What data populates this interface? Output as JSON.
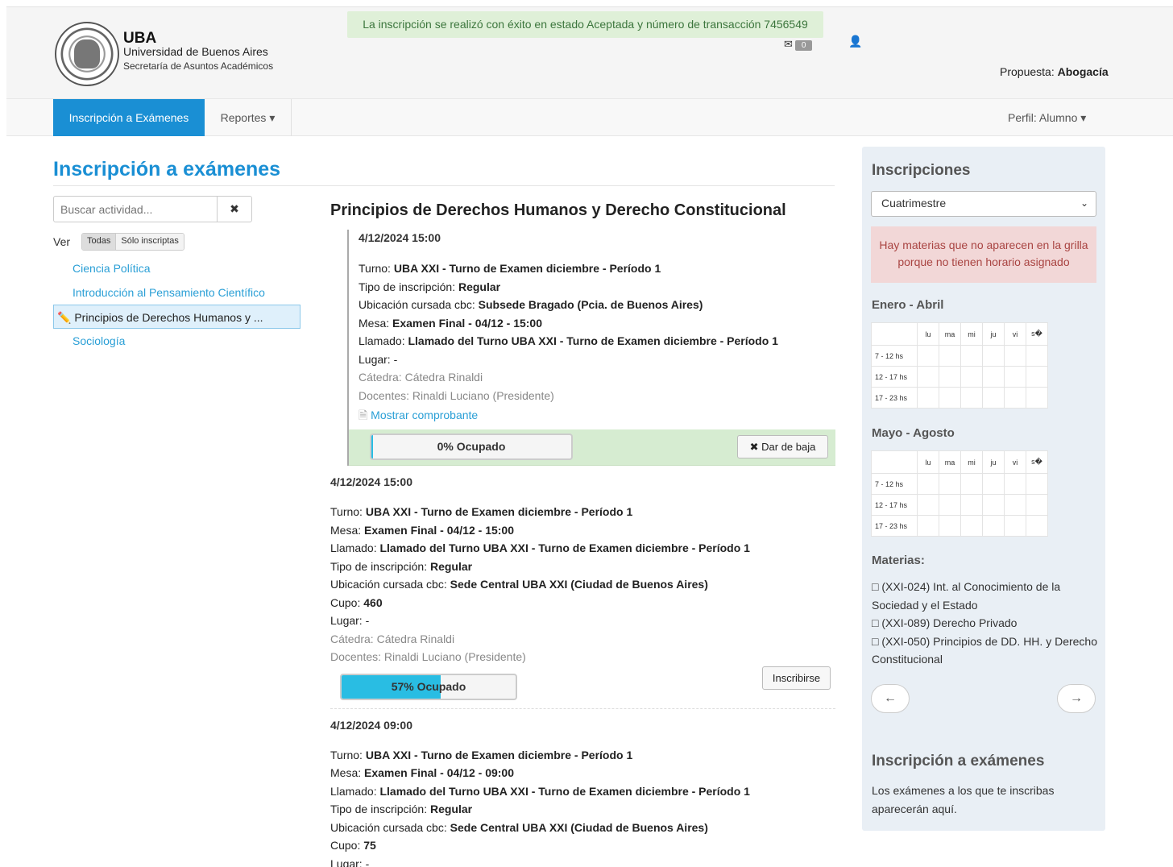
{
  "header": {
    "brand_title": "UBA",
    "brand_subtitle": "Universidad de Buenos Aires",
    "brand_subtitle2": "Secretaría de Asuntos Académicos",
    "flash": "La inscripción se realizó con éxito en estado Aceptada y número de transacción 7456549",
    "mail_count": "0",
    "propuesta_label": "Propuesta:",
    "propuesta_value": "Abogacía"
  },
  "nav": {
    "active": "Inscripción a Exámenes",
    "reportes": "Reportes ▾",
    "perfil": "Perfil: Alumno ▾"
  },
  "page": {
    "title": "Inscripción a exámenes",
    "search_placeholder": "Buscar actividad...",
    "search_clear": "✖",
    "ver_label": "Ver",
    "ver_todas": "Todas",
    "ver_solo": "Sólo inscriptas",
    "activities": [
      "Ciencia Política",
      "Introducción al Pensamiento Científico",
      "Principios de Derechos Humanos y ...",
      "Sociología"
    ]
  },
  "main": {
    "subject": "Principios de Derechos Humanos y Derecho Constitucional",
    "inscribed": {
      "date": "4/12/2024 15:00",
      "turno_l": "Turno:",
      "turno_v": "UBA XXI - Turno de Examen diciembre - Período 1",
      "tipo_l": "Tipo de inscripción:",
      "tipo_v": "Regular",
      "ubic_l": "Ubicación cursada cbc:",
      "ubic_v": "Subsede Bragado (Pcia. de Buenos Aires)",
      "mesa_l": "Mesa:",
      "mesa_v": "Examen Final - 04/12 - 15:00",
      "llamado_l": "Llamado:",
      "llamado_v": "Llamado del Turno UBA XXI - Turno de Examen diciembre - Período 1",
      "lugar": "Lugar: -",
      "catedra": "Cátedra: Cátedra Rinaldi",
      "docentes": "Docentes: Rinaldi Luciano (Presidente)",
      "comprobante": "Mostrar comprobante",
      "progress_text": "0% Ocupado",
      "progress_value": 0.01,
      "baja": "✖ Dar de baja"
    },
    "sections": [
      {
        "date": "4/12/2024 15:00",
        "turno_l": "Turno:",
        "turno_v": "UBA XXI - Turno de Examen diciembre - Período 1",
        "mesa_l": "Mesa:",
        "mesa_v": "Examen Final - 04/12 - 15:00",
        "llamado_l": "Llamado:",
        "llamado_v": "Llamado del Turno UBA XXI - Turno de Examen diciembre - Período 1",
        "tipo_l": "Tipo de inscripción:",
        "tipo_v": "Regular",
        "ubic_l": "Ubicación cursada cbc:",
        "ubic_v": "Sede Central UBA XXI (Ciudad de Buenos Aires)",
        "cupo_l": "Cupo:",
        "cupo_v": "460",
        "lugar": "Lugar: -",
        "catedra": "Cátedra: Cátedra Rinaldi",
        "docentes": "Docentes: Rinaldi Luciano (Presidente)",
        "progress_text": "57% Ocupado",
        "progress_value": 0.57,
        "button": "Inscribirse"
      },
      {
        "date": "4/12/2024 09:00",
        "turno_l": "Turno:",
        "turno_v": "UBA XXI - Turno de Examen diciembre - Período 1",
        "mesa_l": "Mesa:",
        "mesa_v": "Examen Final - 04/12 - 09:00",
        "llamado_l": "Llamado:",
        "llamado_v": "Llamado del Turno UBA XXI - Turno de Examen diciembre - Período 1",
        "tipo_l": "Tipo de inscripción:",
        "tipo_v": "Regular",
        "ubic_l": "Ubicación cursada cbc:",
        "ubic_v": "Sede Central UBA XXI (Ciudad de Buenos Aires)",
        "cupo_l": "Cupo:",
        "cupo_v": "75",
        "lugar": "Lugar: -"
      }
    ]
  },
  "sidebar": {
    "title": "Inscripciones",
    "select_value": "Cuatrimestre",
    "alert": "Hay materias que no aparecen en la grilla porque no tienen horario asignado",
    "period1": "Enero - Abril",
    "period2": "Mayo - Agosto",
    "days": [
      "lu",
      "ma",
      "mi",
      "ju",
      "vi",
      "s�"
    ],
    "rows": [
      "7 - 12 hs",
      "12 - 17 hs",
      "17 - 23 hs"
    ],
    "materias_title": "Materias:",
    "materias": [
      "(XXI-024) Int. al Conocimiento de la Sociedad y el Estado",
      "(XXI-089) Derecho Privado",
      "(XXI-050) Principios de DD. HH. y Derecho Constitucional"
    ],
    "prev": "←",
    "next": "→",
    "exams_title": "Inscripción a exámenes",
    "exams_text": "Los exámenes a los que te inscribas aparecerán aquí."
  },
  "colors": {
    "accent": "#1a8fd4",
    "success_bg": "#dff0d8",
    "progress": "#29bde3",
    "alert_bg": "#f2d7d7"
  }
}
